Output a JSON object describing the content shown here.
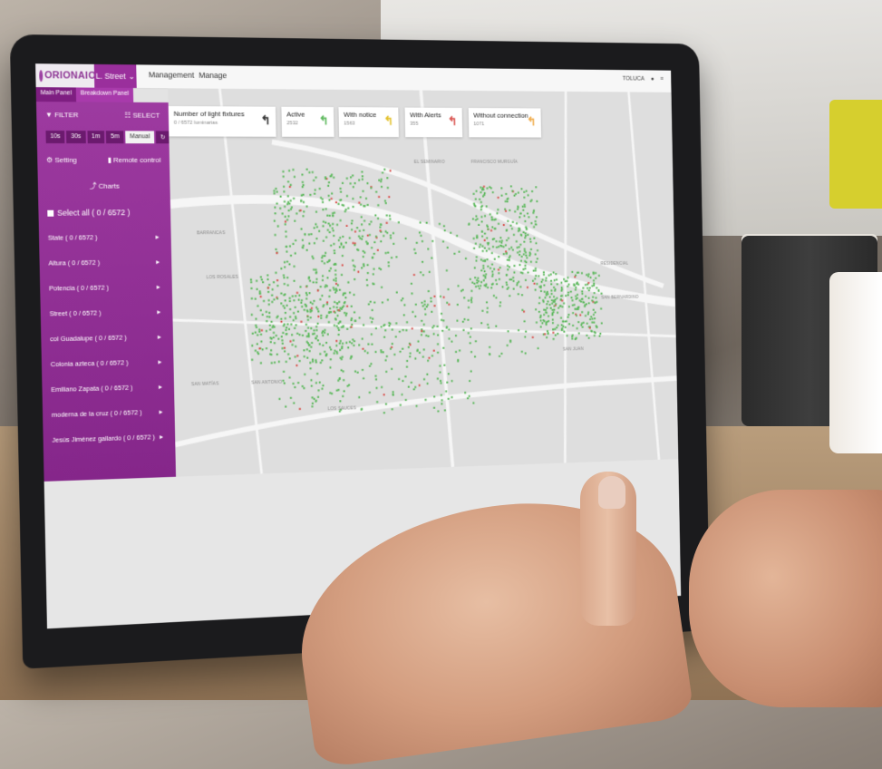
{
  "app": {
    "logo_text": "ORIONAIOT",
    "city_selector": "L. Street",
    "nav": [
      "Management",
      "Manage"
    ],
    "user": "TOLUCA"
  },
  "subtabs": [
    "Main Panel",
    "Breakdown Panel"
  ],
  "sidebar": {
    "filter": "FILTER",
    "select": "SELECT",
    "intervals": [
      "10s",
      "30s",
      "1m",
      "5m",
      "Manual"
    ],
    "setting": "Setting",
    "remote": "Remote control",
    "charts": "Charts",
    "select_all": "Select all ( 0 / 6572 )",
    "items": [
      "State ( 0 / 6572 )",
      "Altura ( 0 / 6572 )",
      "Potencia ( 0 / 6572 )",
      "Street ( 0 / 6572 )",
      "col Guadalupe ( 0 / 6572 )",
      "Colonia azteca ( 0 / 6572 )",
      "Emiliano Zapata ( 0 / 6572 )",
      "moderna de la cruz ( 0 / 6572 )",
      "Jesús Jiménez gallardo ( 0 / 6572 )"
    ]
  },
  "cards": [
    {
      "title": "Number of light fixtures",
      "value": "0 / 6572 luminarias",
      "color": "#333333"
    },
    {
      "title": "Active",
      "value": "2532",
      "color": "#5cb85c"
    },
    {
      "title": "With notice",
      "value": "1563",
      "color": "#e3c12b"
    },
    {
      "title": "With Alerts",
      "value": "355",
      "color": "#d9534f"
    },
    {
      "title": "Without connection",
      "value": "1071",
      "color": "#f0ad4e"
    }
  ],
  "map_labels": [
    "LOS SAUCES",
    "BARRANCAS",
    "LOS ROSALES",
    "SAN JUAN",
    "RESIDENCIAL",
    "SAN ANTONIO",
    "SAN MATÍAS",
    "EL SEMINARIO",
    "FRANCISCO MURGUÍA",
    "SAN BERNARDINO"
  ],
  "colors": {
    "primary": "#9a2f9c",
    "active": "#5cb85c",
    "alert": "#d9534f"
  }
}
